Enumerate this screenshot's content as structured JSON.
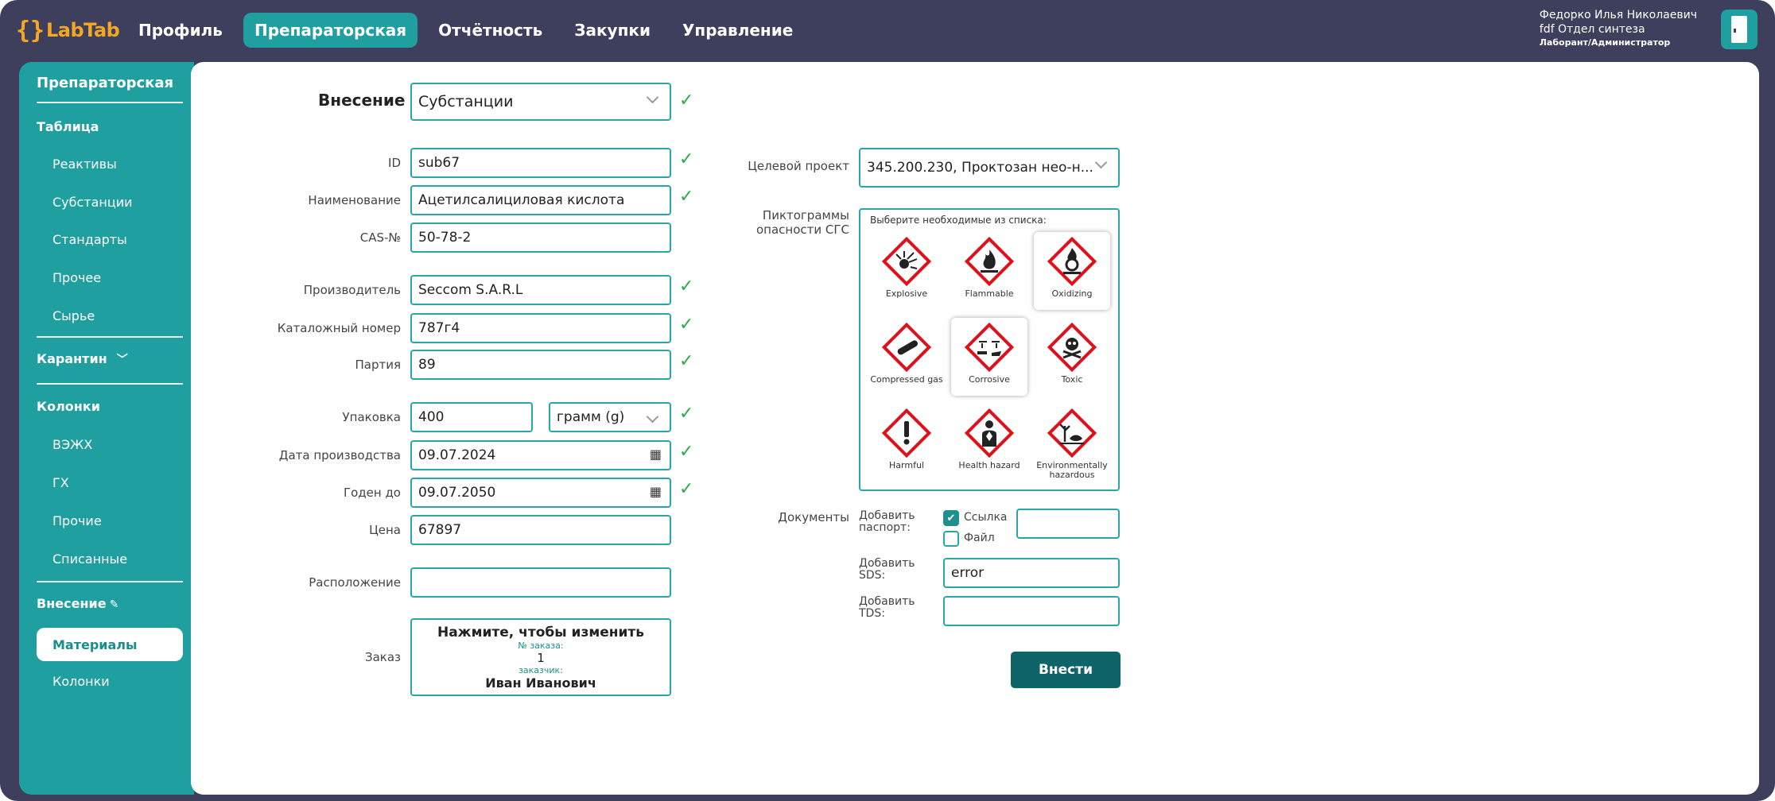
{
  "app": {
    "logo_text": "LabTab",
    "logo_mark": "{}"
  },
  "nav": [
    {
      "label": "Профиль"
    },
    {
      "label": "Препараторская",
      "active": true
    },
    {
      "label": "Отчётность"
    },
    {
      "label": "Закупки"
    },
    {
      "label": "Управление"
    }
  ],
  "user": {
    "name": "Федорко Илья Николаевич",
    "dept": "fdf Отдел синтеза",
    "role": "Лаборант/Администратор"
  },
  "sidebar": {
    "title": "Препараторская",
    "table_head": "Таблица",
    "table_items": [
      "Реактивы",
      "Субстанции",
      "Стандарты",
      "Прочее",
      "Сырье"
    ],
    "quarantine": "Карантин",
    "columns_head": "Колонки",
    "column_items": [
      "ВЭЖХ",
      "ГХ",
      "Прочие",
      "Списанные"
    ],
    "entry_head": "Внесение",
    "entry_items": [
      "Материалы",
      "Колонки"
    ]
  },
  "form": {
    "entry_label": "Внесение",
    "entry_type": "Субстанции",
    "labels": {
      "id": "ID",
      "name": "Наименование",
      "cas": "CAS-№",
      "manufacturer": "Производитель",
      "catalog": "Каталожный номер",
      "batch": "Партия",
      "package": "Упаковка",
      "prod_date": "Дата производства",
      "expiry": "Годен до",
      "price": "Цена",
      "location": "Расположение",
      "order": "Заказ"
    },
    "values": {
      "id": "sub67",
      "name": "Ацетилсалициловая кислота",
      "cas": "50-78-2",
      "manufacturer": "Seccom S.A.R.L",
      "catalog": "787г4",
      "batch": "89",
      "package_amount": "400",
      "package_unit": "грамм (g)",
      "prod_date": "09.07.2024",
      "expiry": "09.07.2050",
      "price": "67897",
      "location": ""
    },
    "order": {
      "title": "Нажмите, чтобы изменить",
      "num_label": "№ заказа:",
      "num": "1",
      "customer_label": "заказчик:",
      "customer": "Иван Иванович"
    },
    "check_mark": "✓"
  },
  "right": {
    "project_label": "Целевой проект",
    "project_value": "345.200.230, Проктозан нео-н...",
    "hazard_label": "Пиктограммы опасности СГС",
    "hazard_hint": "Выберите необходимые из списка:",
    "hazards": [
      {
        "name": "Explosive",
        "icon": "explosive-icon",
        "selected": false
      },
      {
        "name": "Flammable",
        "icon": "flame-icon",
        "selected": false
      },
      {
        "name": "Oxidizing",
        "icon": "flame-over-circle-icon",
        "selected": true
      },
      {
        "name": "Compressed gas",
        "icon": "gas-cylinder-icon",
        "selected": false
      },
      {
        "name": "Corrosive",
        "icon": "corrosion-icon",
        "selected": true
      },
      {
        "name": "Toxic",
        "icon": "skull-icon",
        "selected": false
      },
      {
        "name": "Harmful",
        "icon": "exclamation-icon",
        "selected": false
      },
      {
        "name": "Health hazard",
        "icon": "health-hazard-icon",
        "selected": false
      },
      {
        "name": "Environmentally hazardous",
        "icon": "environment-icon",
        "selected": false
      }
    ],
    "documents_label": "Документы",
    "passport_label": "Добавить паспорт:",
    "link_label": "Ссылка",
    "link_checked": true,
    "file_label": "Файл",
    "file_checked": false,
    "passport_value": "",
    "sds_label": "Добавить SDS:",
    "sds_value": "error",
    "tds_label": "Добавить TDS:",
    "tds_value": "",
    "submit_label": "Внести"
  },
  "colors": {
    "frame": "#3d3f5c",
    "accent": "#1f9f9f",
    "border": "#2aa6a6",
    "submit": "#0e6468",
    "check": "#2eaa4a",
    "logo": "#f5a623",
    "ghs_red": "#e0101b"
  }
}
